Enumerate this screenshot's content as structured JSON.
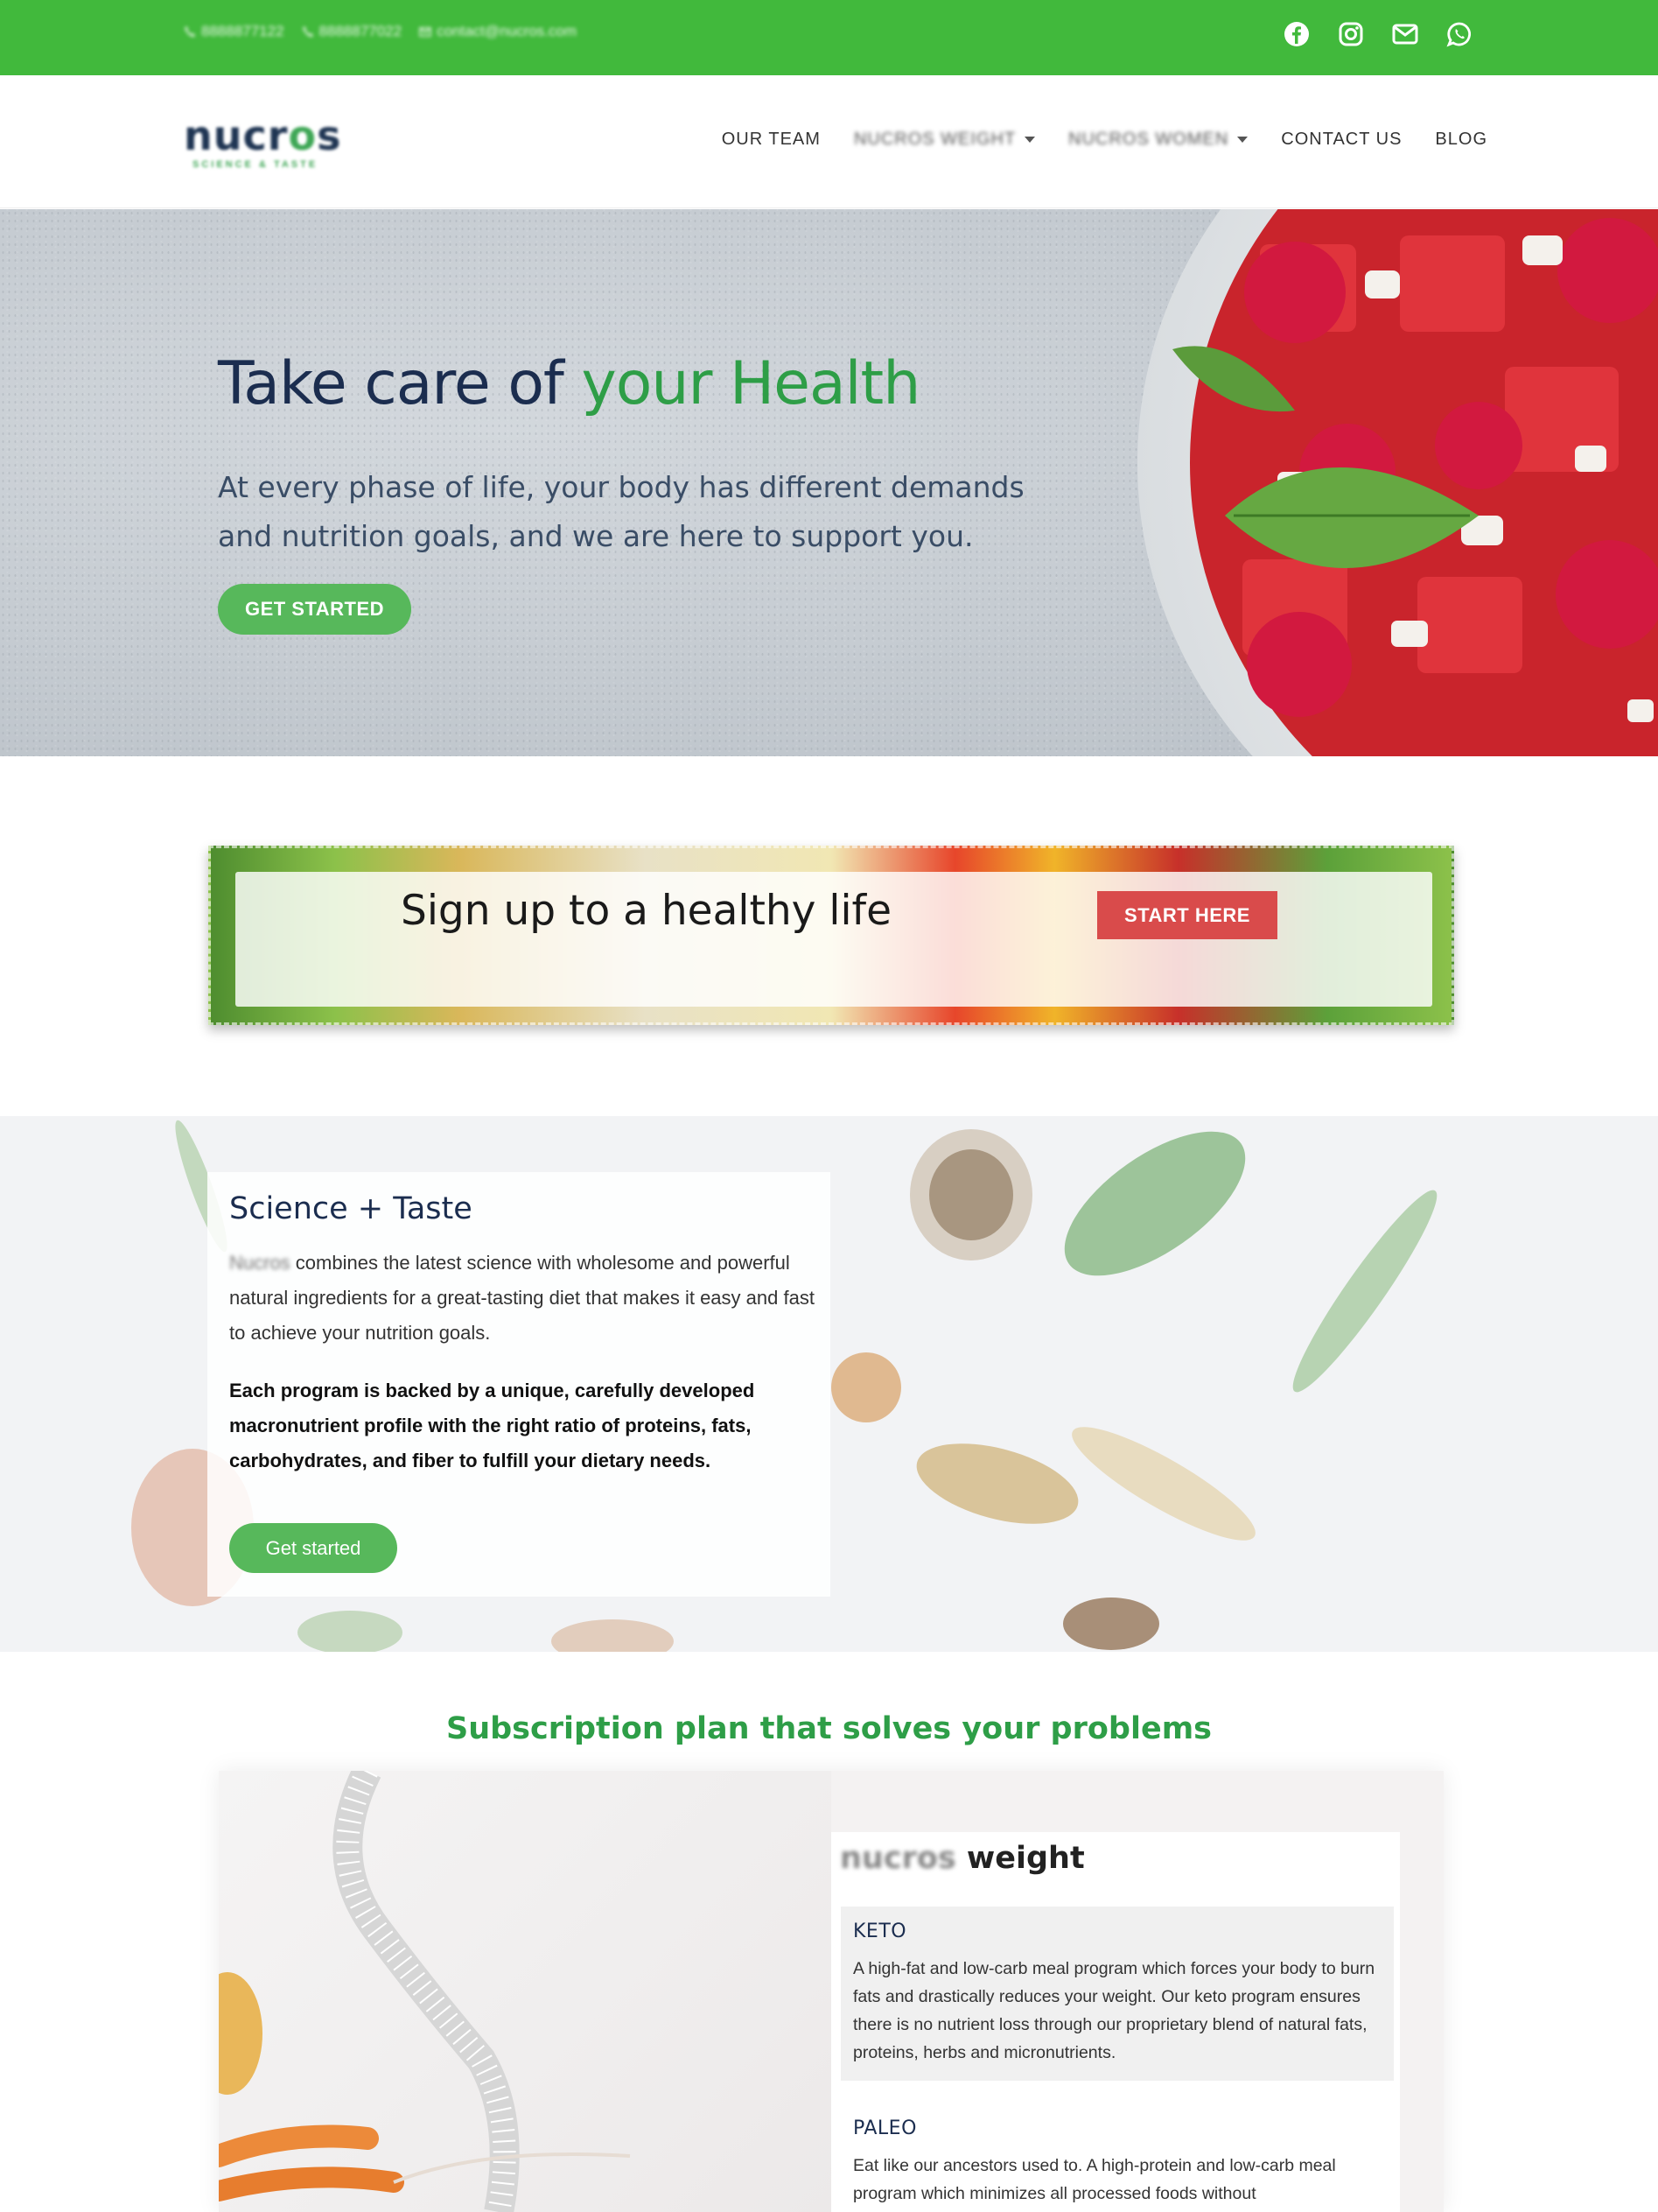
{
  "topbar": {
    "contacts": [
      {
        "icon": "phone-icon",
        "text": "8888877122"
      },
      {
        "icon": "phone-icon",
        "text": "8888877022"
      },
      {
        "icon": "envelope-icon",
        "text": "contact@nucros.com"
      }
    ],
    "social": [
      "facebook-icon",
      "instagram-icon",
      "mail-icon",
      "whatsapp-icon"
    ]
  },
  "header": {
    "logo": {
      "text_start": "nucr",
      "text_o": "o",
      "text_end": "s",
      "tagline": "SCIENCE & TASTE"
    },
    "nav": [
      {
        "label": "OUR TEAM"
      },
      {
        "label": "NUCROS WEIGHT"
      },
      {
        "label": "NUCROS WOMEN"
      },
      {
        "label": "CONTACT US"
      },
      {
        "label": "BLOG"
      }
    ]
  },
  "hero": {
    "title_part1": "Take care of ",
    "title_part2": "your Health",
    "subtitle": "At every phase of life, your body has different demands and nutrition goals, and we are here to support you.",
    "cta": "GET STARTED"
  },
  "signup": {
    "title": "Sign up to a healthy life",
    "cta": "START HERE"
  },
  "science": {
    "title": "Science + Taste",
    "p1_brand": "Nucros",
    "p1_rest": " combines the latest science with wholesome and powerful natural ingredients for a great-tasting diet that makes it easy and fast to achieve your nutrition goals.",
    "p2": "Each program is backed by a unique, carefully developed macronutrient profile with the right ratio of proteins, fats, carbohydrates, and fiber to fulfill your dietary needs.",
    "cta": "Get started"
  },
  "subscription": {
    "heading": "Subscription plan that solves your problems",
    "plan_title_brand": "nucros ",
    "plan_title_rest": "weight",
    "options": [
      {
        "title": "KETO",
        "text": "A high-fat and low-carb meal program which forces your body to burn fats and drastically reduces your weight. Our keto program ensures there is no nutrient loss through our proprietary blend of natural fats, proteins, herbs and micronutrients."
      },
      {
        "title": "PALEO",
        "text": "Eat like our ancestors used to. A high-protein and low-carb meal program which minimizes all processed foods without"
      }
    ]
  },
  "colors": {
    "topbar_green": "#41b93c",
    "button_green": "#57b85b",
    "heading_navy": "#1b2d4f",
    "accent_green": "#2e9e47",
    "signup_red": "#d94b4b"
  }
}
